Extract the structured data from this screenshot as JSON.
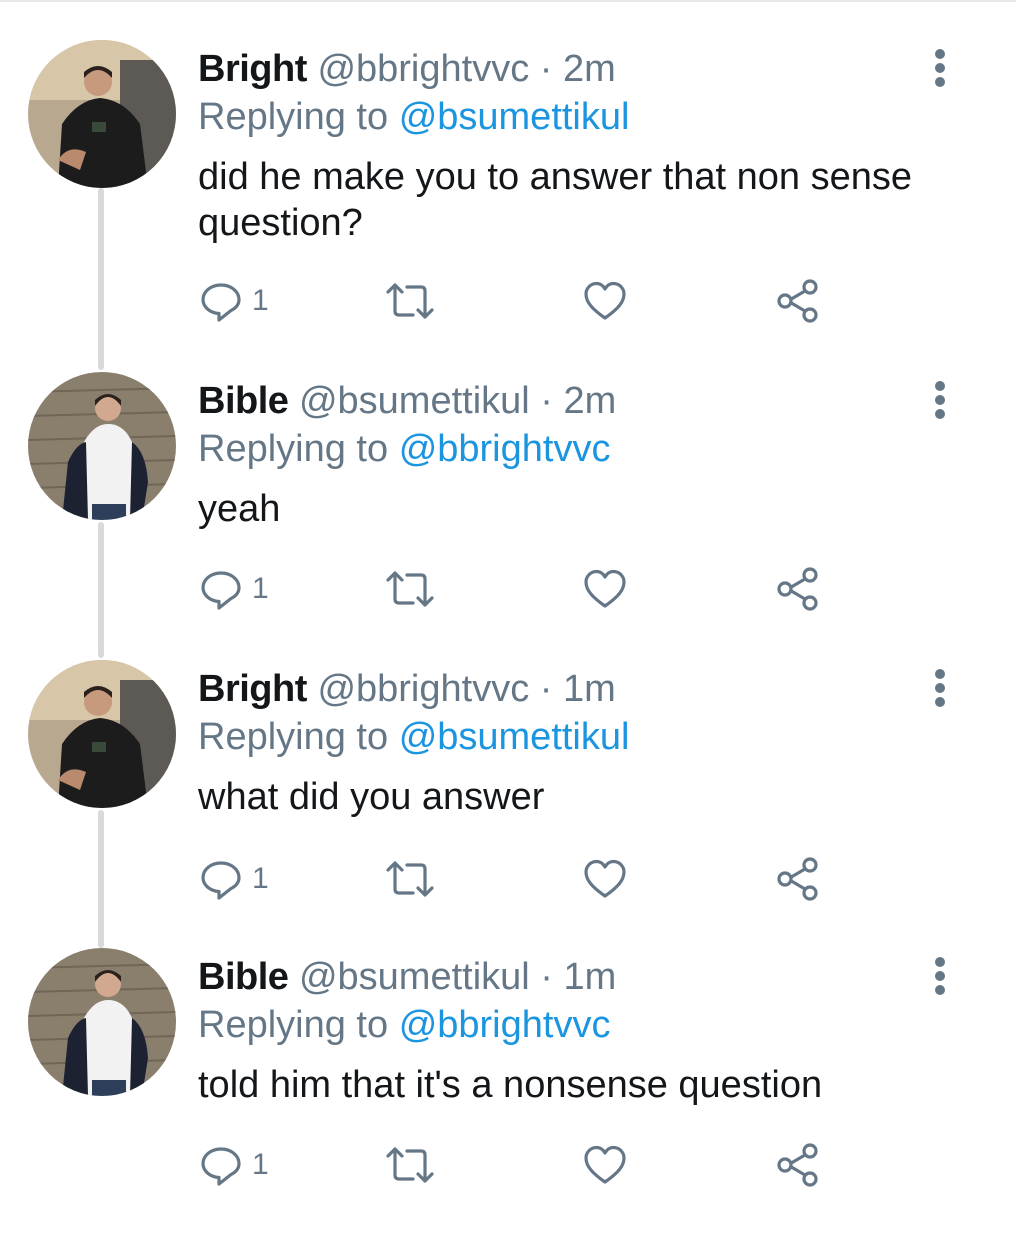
{
  "tweets": [
    {
      "name": "Bright",
      "handle": "@bbrightvvc",
      "separator": "·",
      "time": "2m",
      "replying_prefix": "Replying to",
      "replying_to": "@bsumettikul",
      "text": "did he make you to answer that non sense question?",
      "reply_count": "1"
    },
    {
      "name": "Bible",
      "handle": "@bsumettikul",
      "separator": "·",
      "time": "2m",
      "replying_prefix": "Replying to",
      "replying_to": "@bbrightvvc",
      "text": "yeah",
      "reply_count": "1"
    },
    {
      "name": "Bright",
      "handle": "@bbrightvvc",
      "separator": "·",
      "time": "1m",
      "replying_prefix": "Replying to",
      "replying_to": "@bsumettikul",
      "text": "what did you answer",
      "reply_count": "1"
    },
    {
      "name": "Bible",
      "handle": "@bsumettikul",
      "separator": "·",
      "time": "1m",
      "replying_prefix": "Replying to",
      "replying_to": "@bbrightvvc",
      "text": "told him that it's a nonsense question",
      "reply_count": "1"
    }
  ],
  "icons": {
    "more": "more-vertical-icon",
    "reply": "reply-bubble-icon",
    "retweet": "retweet-icon",
    "like": "heart-icon",
    "share": "share-icon"
  },
  "colors": {
    "text": "#14171a",
    "secondary": "#657786",
    "link": "#1b95e0",
    "thread_line": "#d9d9d9"
  }
}
